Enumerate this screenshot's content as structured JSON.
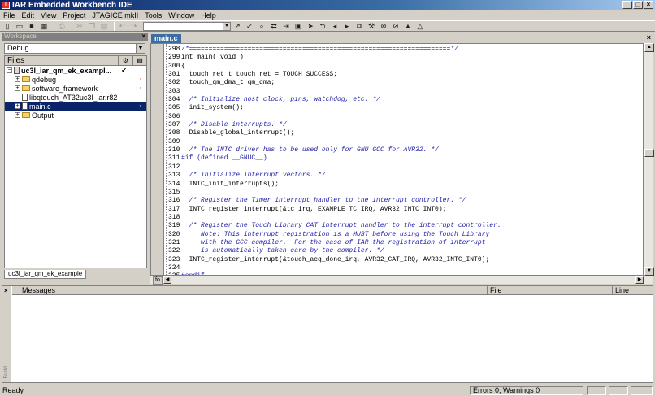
{
  "window": {
    "title": "IAR Embedded Workbench IDE"
  },
  "menu": [
    "File",
    "Edit",
    "View",
    "Project",
    "JTAGICE mkII",
    "Tools",
    "Window",
    "Help"
  ],
  "workspace": {
    "header": "Workspace",
    "config": "Debug",
    "files_header": "Files",
    "tab": "uc3l_iar_qm_ek_example",
    "items": [
      {
        "label": "uc3l_iar_qm_ek_exampl...",
        "mark": "✔"
      },
      {
        "label": "qdebug"
      },
      {
        "label": "software_framework"
      },
      {
        "label": "libqtouch_AT32uc3l_iar.r82"
      },
      {
        "label": "main.c"
      },
      {
        "label": "Output"
      }
    ]
  },
  "editor": {
    "tab": "main.c",
    "fo": "fo",
    "lines": [
      {
        "n": "298",
        "t": "/*===================================================================*/",
        "k": "cmt"
      },
      {
        "n": "299",
        "t": "int main( void )",
        "k": "kw"
      },
      {
        "n": "300",
        "t": "{",
        "k": ""
      },
      {
        "n": "301",
        "t": "  touch_ret_t touch_ret = TOUCH_SUCCESS;",
        "k": ""
      },
      {
        "n": "302",
        "t": "  touch_qm_dma_t qm_dma;",
        "k": ""
      },
      {
        "n": "303",
        "t": "",
        "k": ""
      },
      {
        "n": "304",
        "t": "  /* Initialize host clock, pins, watchdog, etc. */",
        "k": "cmt"
      },
      {
        "n": "305",
        "t": "  init_system();",
        "k": ""
      },
      {
        "n": "306",
        "t": "",
        "k": ""
      },
      {
        "n": "307",
        "t": "  /* Disable interrupts. */",
        "k": "cmt"
      },
      {
        "n": "308",
        "t": "  Disable_global_interrupt();",
        "k": ""
      },
      {
        "n": "309",
        "t": "",
        "k": ""
      },
      {
        "n": "310",
        "t": "  /* The INTC driver has to be used only for GNU GCC for AVR32. */",
        "k": "cmt"
      },
      {
        "n": "311",
        "t": "#if (defined __GNUC__)",
        "k": "pp"
      },
      {
        "n": "312",
        "t": "",
        "k": ""
      },
      {
        "n": "313",
        "t": "  /* initialize interrupt vectors. */",
        "k": "cmt"
      },
      {
        "n": "314",
        "t": "  INTC_init_interrupts();",
        "k": ""
      },
      {
        "n": "315",
        "t": "",
        "k": ""
      },
      {
        "n": "316",
        "t": "  /* Register the Timer interrupt handler to the interrupt controller. */",
        "k": "cmt"
      },
      {
        "n": "317",
        "t": "  INTC_register_interrupt(&tc_irq, EXAMPLE_TC_IRQ, AVR32_INTC_INT0);",
        "k": ""
      },
      {
        "n": "318",
        "t": "",
        "k": ""
      },
      {
        "n": "319",
        "t": "  /* Register the Touch Library CAT interrupt handler to the interrupt controller.",
        "k": "cmt"
      },
      {
        "n": "320",
        "t": "     Note: This interrupt registration is a MUST before using the Touch Library",
        "k": "cmt"
      },
      {
        "n": "321",
        "t": "     with the GCC compiler.  For the case of IAR the registration of interrupt",
        "k": "cmt"
      },
      {
        "n": "322",
        "t": "     is automatically taken care by the compiler. */",
        "k": "cmt"
      },
      {
        "n": "323",
        "t": "  INTC_register_interrupt(&touch_acq_done_irq, AVR32_CAT_IRQ, AVR32_INTC_INT0);",
        "k": ""
      },
      {
        "n": "324",
        "t": "",
        "k": ""
      },
      {
        "n": "325",
        "t": "#endif",
        "k": "pp"
      }
    ]
  },
  "messages": {
    "side_label": "Build",
    "col_messages": "Messages",
    "col_file": "File",
    "col_line": "Line"
  },
  "status": {
    "ready": "Ready",
    "errors": "Errors 0, Warnings 0"
  }
}
